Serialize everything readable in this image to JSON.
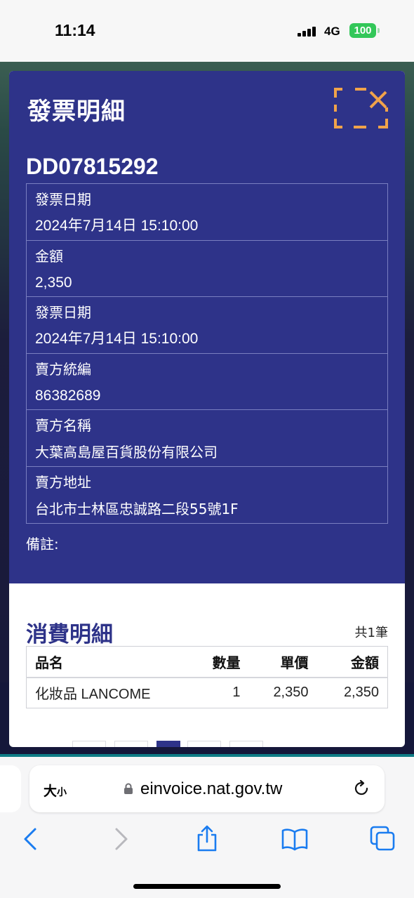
{
  "status_bar": {
    "time": "11:14",
    "network": "4G",
    "battery": "100"
  },
  "modal": {
    "title": "發票明細",
    "invoice_number": "DD07815292",
    "fields": [
      {
        "label": "發票日期",
        "value": "2024年7月14日 15:10:00"
      },
      {
        "label": "金額",
        "value": "2,350"
      },
      {
        "label": "發票日期",
        "value": "2024年7月14日 15:10:00"
      },
      {
        "label": "賣方統編",
        "value": "86382689"
      },
      {
        "label": "賣方名稱",
        "value": "大葉高島屋百貨股份有限公司"
      },
      {
        "label": "賣方地址",
        "value": "台北市士林區忠誠路二段55號1F"
      }
    ],
    "remark_label": "備註:",
    "detail": {
      "title": "消費明細",
      "count": "共1筆",
      "headers": {
        "name": "品名",
        "qty": "數量",
        "unit": "單價",
        "amount": "金額"
      },
      "rows": [
        {
          "name": "化妝品 LANCOME",
          "qty": "1",
          "unit": "2,350",
          "amount": "2,350"
        }
      ]
    }
  },
  "browser": {
    "text_size": "大",
    "text_size_small": "小",
    "url": "einvoice.nat.gov.tw"
  },
  "icons": {
    "close": "close-icon",
    "back": "chevron-left-icon",
    "forward": "chevron-right-icon",
    "share": "share-icon",
    "bookmarks": "book-icon",
    "tabs": "tabs-icon"
  },
  "colors": {
    "modal_header": "#2e3389",
    "close_accent": "#f0a34a",
    "ios_blue": "#1a7cf0",
    "battery": "#33c759"
  }
}
